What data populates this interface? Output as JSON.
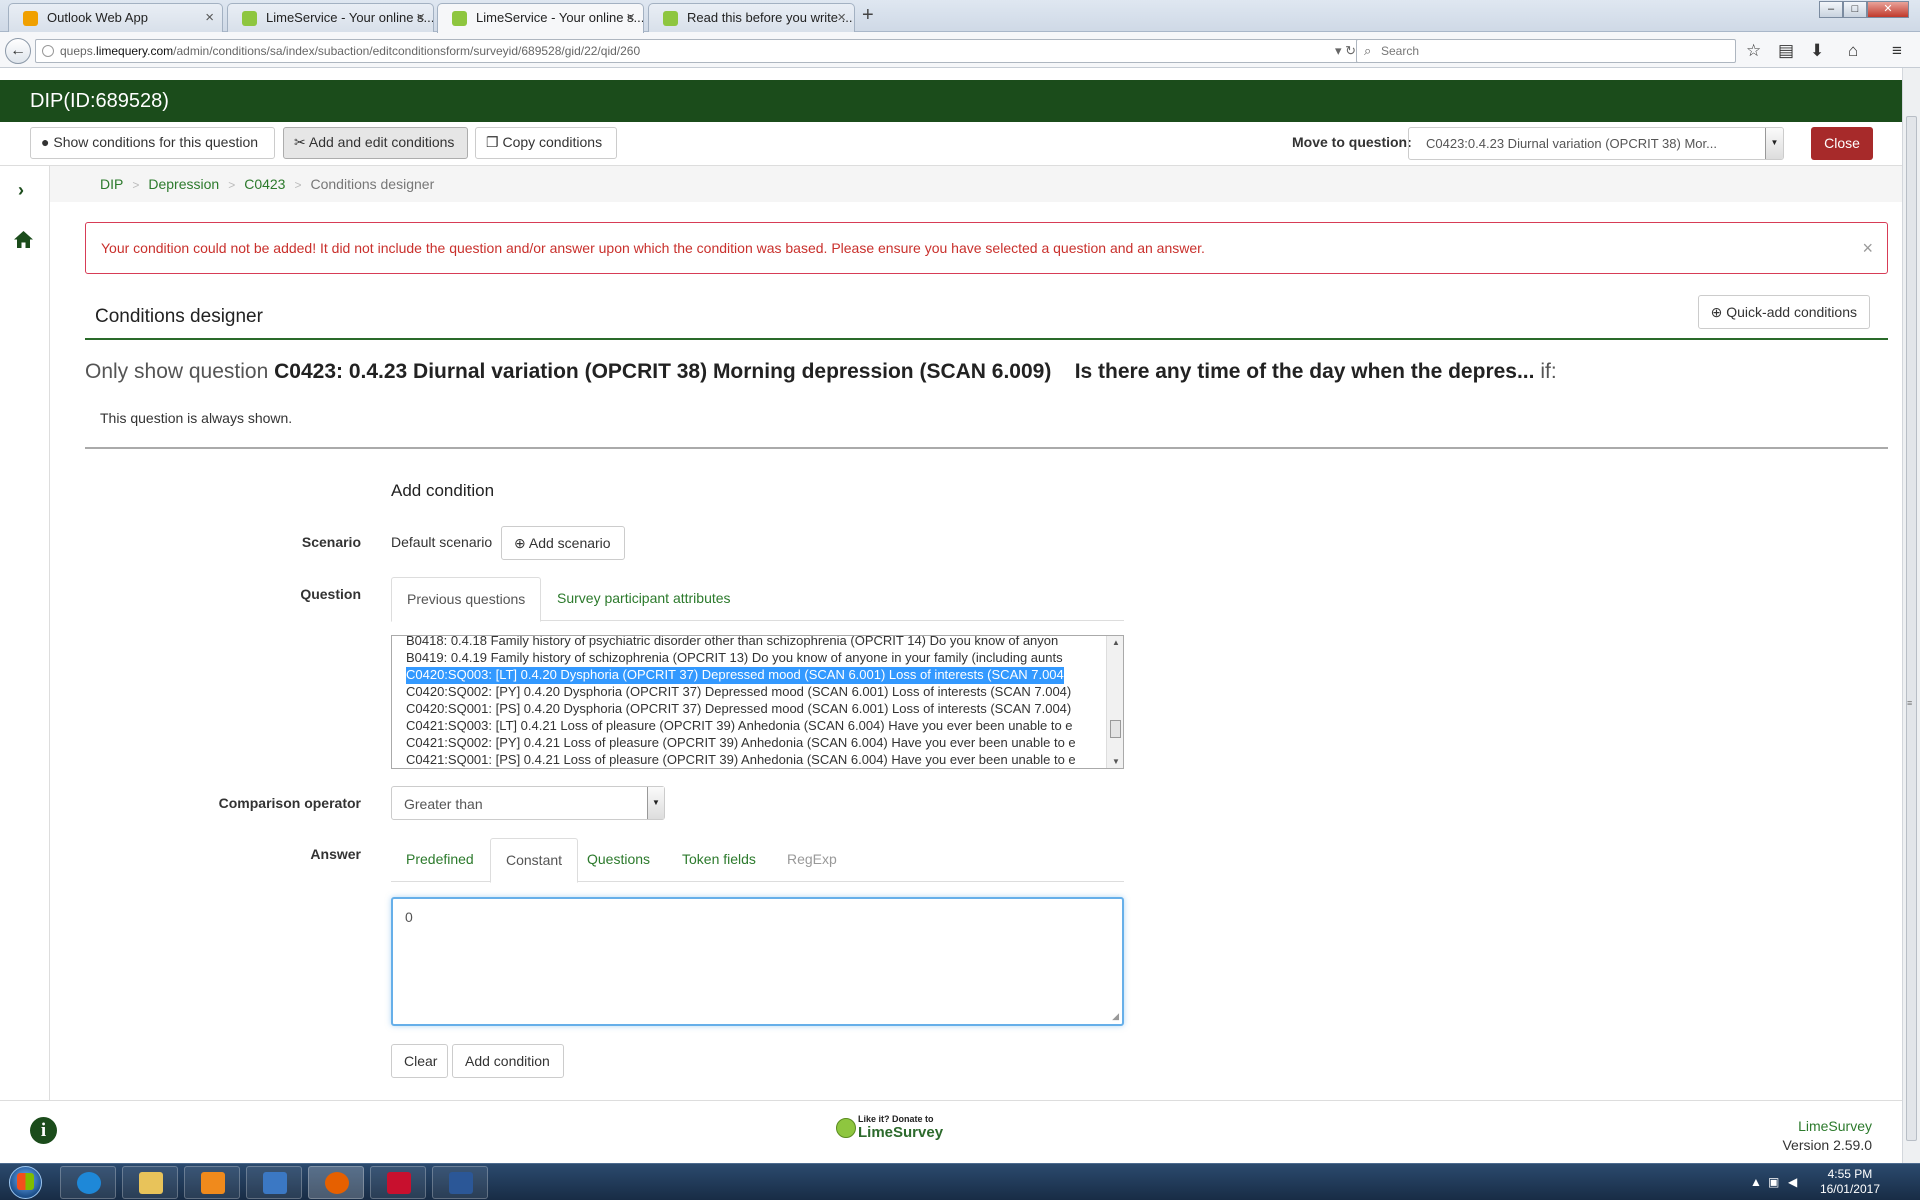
{
  "browser": {
    "tabs": [
      {
        "label": "Outlook Web App",
        "color": "#f0a000"
      },
      {
        "label": "LimeService - Your online s...",
        "color": "#8ec63f"
      },
      {
        "label": "LimeService - Your online s...",
        "color": "#8ec63f"
      },
      {
        "label": "Read this before you write ...",
        "color": "#8ec63f"
      }
    ],
    "url_prefix": "queps.",
    "url_domain": "limequery.com",
    "url_path": "/admin/conditions/sa/index/subaction/editconditionsform/surveyid/689528/gid/22/qid/260",
    "search_placeholder": "Search"
  },
  "header": {
    "title": "DIP(ID:689528)"
  },
  "toolbar": {
    "show_conditions": "Show conditions for this question",
    "add_edit_conditions": "Add and edit conditions",
    "copy_conditions": "Copy conditions",
    "move_label": "Move to question:",
    "move_value": "C0423:0.4.23 Diurnal variation (OPCRIT 38) Mor...",
    "close": "Close"
  },
  "breadcrumb": {
    "items": [
      "DIP",
      "Depression",
      "C0423"
    ],
    "current": "Conditions designer",
    "sep": ">"
  },
  "alert": {
    "message": "Your condition could not be added! It did not include the question and/or answer upon which the condition was based. Please ensure you have selected a question and an answer."
  },
  "panel": {
    "title": "Conditions designer",
    "quick_add": "Quick-add conditions"
  },
  "only_show": {
    "prefix": "Only show question",
    "question": "C0423: 0.4.23 Diurnal variation (OPCRIT 38) Morning depression (SCAN 6.009)",
    "question_text": "Is there any time of the day when the depres...",
    "suffix": "if:"
  },
  "always_shown": "This question is always shown.",
  "add_condition": {
    "title": "Add condition",
    "scenario_label": "Scenario",
    "scenario_value": "Default scenario",
    "add_scenario": "Add scenario",
    "question_label": "Question",
    "question_tabs": [
      "Previous questions",
      "Survey participant attributes"
    ],
    "question_options": [
      {
        "text": "B0418: 0.4.18 Family history of psychiatric disorder other than schizophrenia (OPCRIT 14) Do you know of anyon",
        "selected": false
      },
      {
        "text": "B0419: 0.4.19 Family history of schizophrenia (OPCRIT 13) Do you know of anyone in your family (including aunts",
        "selected": false
      },
      {
        "text": "C0420:SQ003: [LT] 0.4.20 Dysphoria (OPCRIT 37) Depressed mood (SCAN 6.001) Loss of interests (SCAN 7.004",
        "selected": true
      },
      {
        "text": "C0420:SQ002: [PY] 0.4.20 Dysphoria (OPCRIT 37) Depressed mood (SCAN 6.001) Loss of interests (SCAN 7.004)",
        "selected": false
      },
      {
        "text": "C0420:SQ001: [PS] 0.4.20 Dysphoria (OPCRIT 37) Depressed mood (SCAN 6.001) Loss of interests (SCAN 7.004)",
        "selected": false
      },
      {
        "text": "C0421:SQ003: [LT] 0.4.21 Loss of pleasure (OPCRIT 39) Anhedonia (SCAN 6.004)   Have you ever been unable to e",
        "selected": false
      },
      {
        "text": "C0421:SQ002: [PY] 0.4.21 Loss of pleasure (OPCRIT 39) Anhedonia (SCAN 6.004)   Have you ever been unable to e",
        "selected": false
      },
      {
        "text": "C0421:SQ001: [PS] 0.4.21 Loss of pleasure (OPCRIT 39) Anhedonia (SCAN 6.004)   Have you ever been unable to e",
        "selected": false
      }
    ],
    "comparison_label": "Comparison operator",
    "comparison_value": "Greater than",
    "answer_label": "Answer",
    "answer_tabs": [
      "Predefined",
      "Constant",
      "Questions",
      "Token fields",
      "RegExp"
    ],
    "answer_value": "0",
    "clear": "Clear",
    "submit": "Add condition"
  },
  "footer": {
    "donate_line1": "Like it? Donate to",
    "donate_line2": "LimeSurvey",
    "brand": "LimeSurvey",
    "version": "Version 2.59.0"
  },
  "taskbar": {
    "time": "4:55 PM",
    "date": "16/01/2017"
  },
  "colors": {
    "brand_green": "#1b4c1b",
    "link_green": "#2c7a2c",
    "danger": "#a72a2a",
    "alert_text": "#c9302c"
  }
}
